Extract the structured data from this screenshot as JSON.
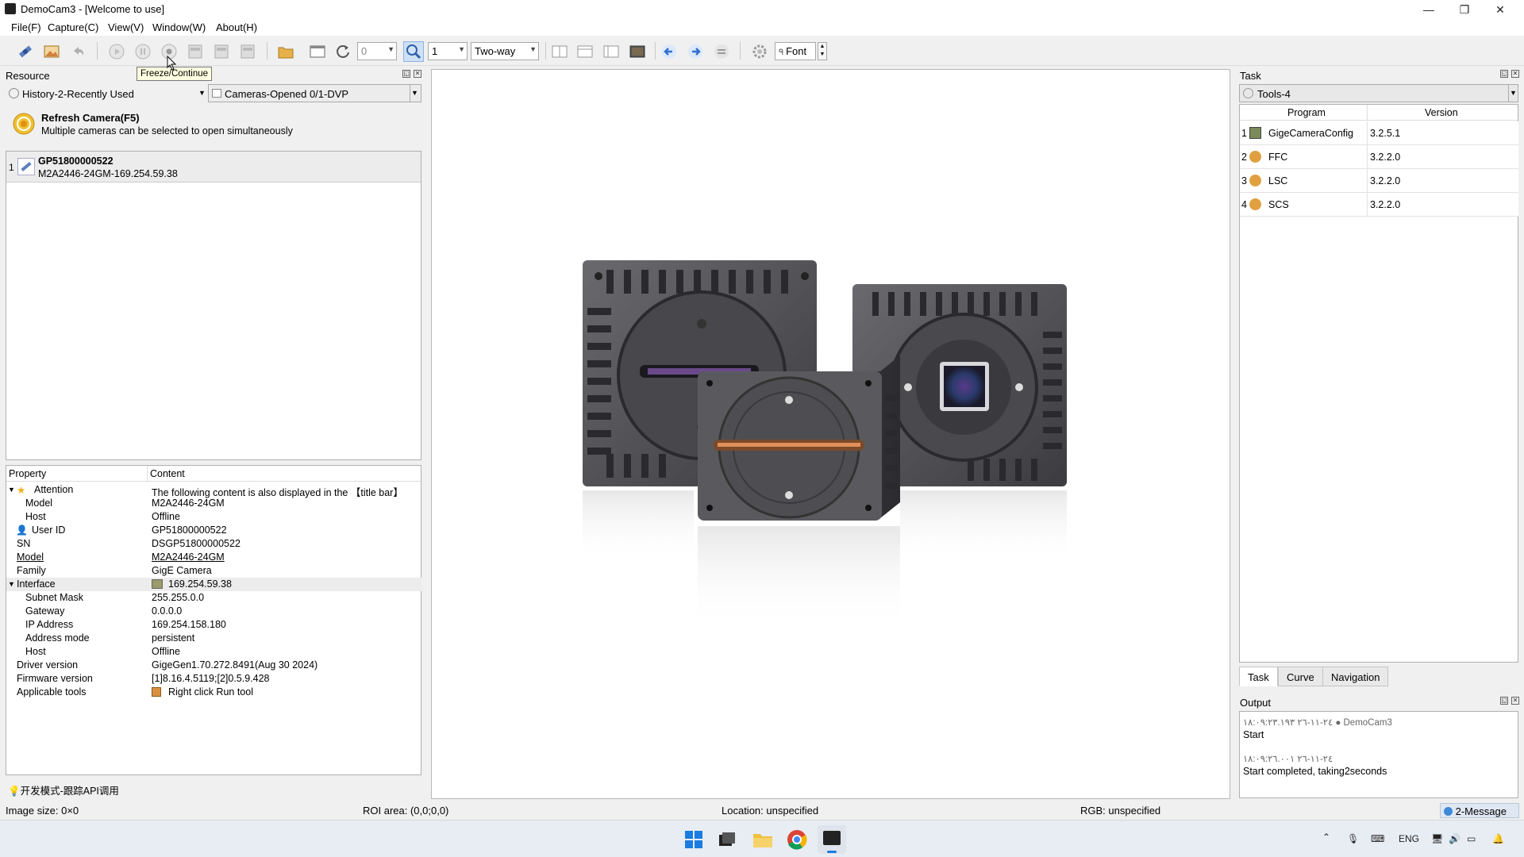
{
  "window": {
    "title": "DemoCam3 - [Welcome to use]",
    "min_label": "—",
    "max_label": "❐",
    "close_label": "✕"
  },
  "menu": [
    {
      "label": "File(F)"
    },
    {
      "label": "Capture(C)"
    },
    {
      "label": "View(V)"
    },
    {
      "label": "Window(W)"
    },
    {
      "label": "About(H)"
    }
  ],
  "toolbar": {
    "frame_count": "0",
    "zoom_value": "1",
    "mode": "Two-way",
    "font_label": "Font",
    "tooltip": "Freeze/Continue"
  },
  "resource": {
    "title": "Resource",
    "history_combo": "History-2-Recently Used",
    "cameras_combo": "Cameras-Opened 0/1-DVP",
    "refresh_title": "Refresh Camera(F5)",
    "refresh_desc": "Multiple cameras can be selected to open simultaneously",
    "camera": {
      "index": "1",
      "serial": "GP51800000522",
      "detail": "M2A2446-24GM-169.254.59.38"
    }
  },
  "properties": {
    "col_property": "Property",
    "col_content": "Content",
    "rows": [
      {
        "key": "Attention",
        "value": "The following content is also displayed in the 【title bar】"
      },
      {
        "key": "Model",
        "value": "M2A2446-24GM"
      },
      {
        "key": "Host",
        "value": "Offline"
      },
      {
        "key": "User ID",
        "value": "GP51800000522"
      },
      {
        "key": "SN",
        "value": "DSGP51800000522"
      },
      {
        "key": "Model",
        "value": "M2A2446-24GM"
      },
      {
        "key": "Family",
        "value": "GigE Camera"
      },
      {
        "key": "Interface",
        "value": "169.254.59.38"
      },
      {
        "key": "Subnet Mask",
        "value": "255.255.0.0"
      },
      {
        "key": "Gateway",
        "value": "0.0.0.0"
      },
      {
        "key": "IP Address",
        "value": "169.254.158.180"
      },
      {
        "key": "Address mode",
        "value": "persistent"
      },
      {
        "key": "Host",
        "value": "Offline"
      },
      {
        "key": "Driver version",
        "value": "GigeGen1.70.272.8491(Aug 30 2024)"
      },
      {
        "key": "Firmware version",
        "value": "[1]8.16.4.5119;[2]0.5.9.428"
      },
      {
        "key": "Applicable tools",
        "value": "Right click Run tool"
      }
    ],
    "footer_hint": "开发模式-跟踪API调用"
  },
  "task": {
    "title": "Task",
    "tools_combo": "Tools-4",
    "col_program": "Program",
    "col_version": "Version",
    "rows": [
      {
        "n": "1",
        "program": "GigeCameraConfig",
        "version": "3.2.5.1"
      },
      {
        "n": "2",
        "program": "FFC",
        "version": "3.2.2.0"
      },
      {
        "n": "3",
        "program": "LSC",
        "version": "3.2.2.0"
      },
      {
        "n": "4",
        "program": "SCS",
        "version": "3.2.2.0"
      }
    ],
    "tabs": [
      {
        "label": "Task"
      },
      {
        "label": "Curve"
      },
      {
        "label": "Navigation"
      }
    ]
  },
  "output": {
    "title": "Output",
    "entries": [
      {
        "time": "٢٤-١١-٢٦ ١٨:٠٩:٢٣.١٩٣ ● DemoCam3",
        "text": "Start"
      },
      {
        "time": "٢٤-١١-٢٦ ١٨:٠٩:٢٦.٠٠١",
        "text": "Start completed, taking2seconds"
      }
    ]
  },
  "status": {
    "image_size": "Image size:  0×0",
    "roi": "ROI area:  (0,0;0,0)",
    "location": "Location: unspecified",
    "rgb": "RGB:  unspecified",
    "message": "2-Message"
  },
  "taskbar": {
    "lang": "ENG"
  },
  "colors": {
    "accent": "#3b7fd8",
    "orange": "#e0a030",
    "window_bg": "#f0f0f0"
  }
}
